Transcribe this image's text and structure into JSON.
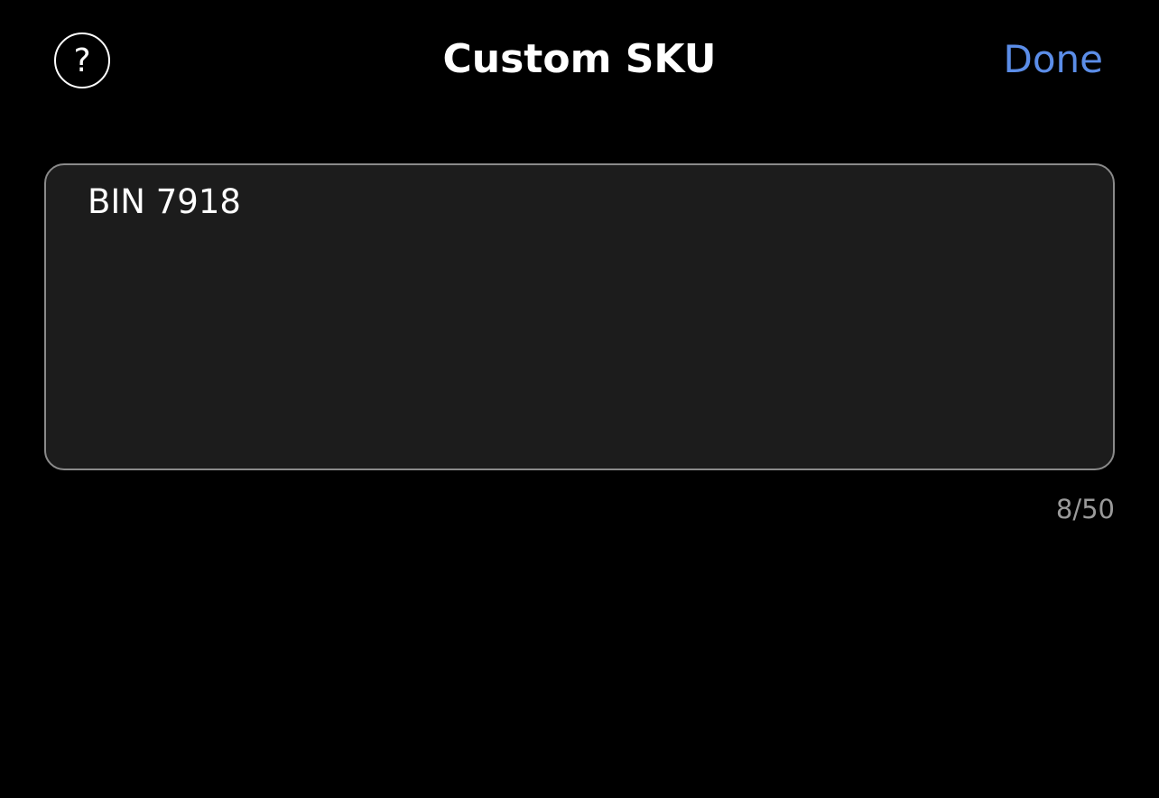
{
  "header": {
    "help_icon": "question-mark-circle",
    "help_glyph": "?",
    "title": "Custom SKU",
    "done_label": "Done"
  },
  "sku_field": {
    "value": "BIN 7918",
    "counter": "8/50"
  },
  "colors": {
    "background": "#000000",
    "accent": "#5b8de8",
    "field_background": "#1c1c1c",
    "field_border": "#8a8a8a",
    "muted_text": "#9a9a9a"
  }
}
